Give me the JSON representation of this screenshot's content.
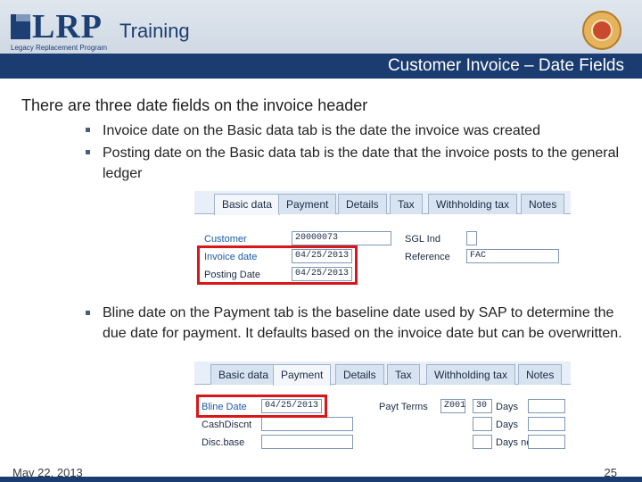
{
  "header": {
    "logo_text": "LRP",
    "logo_tagline": "Legacy Replacement Program",
    "section": "Training",
    "title": "Customer Invoice – Date Fields"
  },
  "content": {
    "heading": "There are three date fields on the invoice header",
    "bullets": [
      "Invoice date on the Basic data tab is the date the invoice was created",
      "Posting date on the Basic data tab is the date that the invoice posts to the general ledger",
      "Bline date on the Payment tab is the baseline date used by SAP to determine the due date for payment. It defaults based on the invoice date but can be overwritten."
    ]
  },
  "screen1": {
    "tabs": [
      "Basic data",
      "Payment",
      "Details",
      "Tax",
      "Withholding tax",
      "Notes"
    ],
    "fields": {
      "customer_label": "Customer",
      "customer_value": "20000073",
      "invoice_date_label": "Invoice date",
      "invoice_date_value": "04/25/2013",
      "posting_date_label": "Posting Date",
      "posting_date_value": "04/25/2013",
      "sgl_label": "SGL Ind",
      "reference_label": "Reference",
      "reference_value": "FAC"
    }
  },
  "screen2": {
    "tabs": [
      "Basic data",
      "Payment",
      "Details",
      "Tax",
      "Withholding tax",
      "Notes"
    ],
    "fields": {
      "bline_label": "Bline Date",
      "bline_value": "04/25/2013",
      "cashdiscnt_label": "CashDiscnt",
      "discbase_label": "Disc.base",
      "payt_terms_label": "Payt Terms",
      "payt_terms_value": "Z001",
      "days1_value": "30",
      "days_label": "Days",
      "days_net_label": "Days net"
    }
  },
  "footer": {
    "date": "May 22, 2013",
    "page": "25"
  },
  "colors": {
    "title_bar": "#1a3c70",
    "highlight": "#d81818"
  }
}
